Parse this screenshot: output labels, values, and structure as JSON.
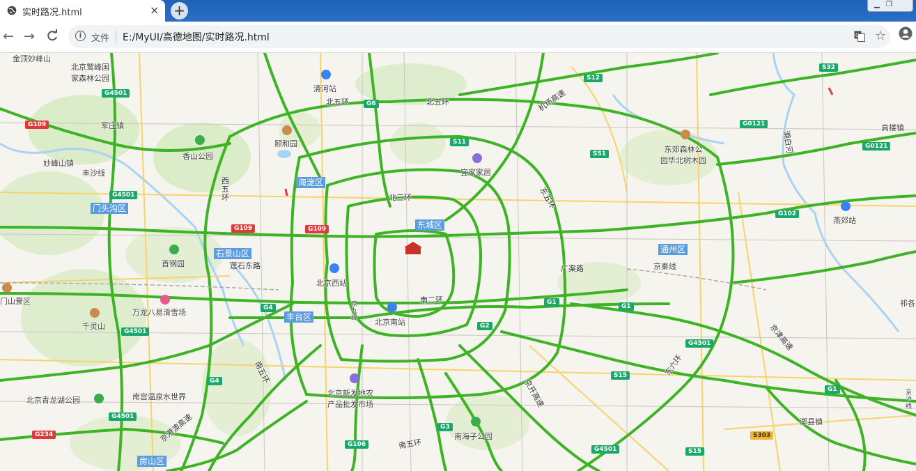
{
  "browser": {
    "tab_title": "实时路况.html",
    "tab_close": "×",
    "new_tab": "+",
    "file_label": "文件",
    "url": "E:/MyUI/高德地图/实时路况.html",
    "back": "←",
    "forward": "→",
    "reload": "C",
    "info": "i",
    "star": "☆"
  },
  "map": {
    "place_labels": [
      {
        "id": "jindingmiaofeng",
        "text": "金顶妙峰山"
      },
      {
        "id": "jingfeng",
        "text": "北京鹫峰国\n家森林公园"
      },
      {
        "id": "qinghe-station",
        "text": "清河站"
      },
      {
        "id": "junzhuang",
        "text": "军庄镇"
      },
      {
        "id": "yiheyuan",
        "text": "颐和园"
      },
      {
        "id": "xiangshan",
        "text": "香山公园"
      },
      {
        "id": "miaofengshan-town",
        "text": "妙峰山镇"
      },
      {
        "id": "fengsha-line",
        "text": "丰沙线"
      },
      {
        "id": "yijiajiayuan",
        "text": "宜家家居"
      },
      {
        "id": "dongjiao",
        "text": "东郊森林公\n园华北树木园"
      },
      {
        "id": "gaolouzhen",
        "text": "高楼镇"
      },
      {
        "id": "yanjiao",
        "text": "燕郊站"
      },
      {
        "id": "shougang",
        "text": "首钢园"
      },
      {
        "id": "mentougou-shan",
        "text": "门山景区"
      },
      {
        "id": "beijing-west",
        "text": "北京西站"
      },
      {
        "id": "wanlong",
        "text": "万龙八易滑雪场"
      },
      {
        "id": "qianlingshan",
        "text": "千灵山"
      },
      {
        "id": "beijing-south",
        "text": "北京南站"
      },
      {
        "id": "jingjiu-line",
        "text": "京\n九\n线"
      },
      {
        "id": "jingqin-line",
        "text": "京秦线"
      },
      {
        "id": "xinfadi",
        "text": "北京新发地农\n产品批发市场"
      },
      {
        "id": "nangong",
        "text": "南宫温泉水世界"
      },
      {
        "id": "qinglonghu",
        "text": "北京青龙湖公园"
      },
      {
        "id": "nanhaizi",
        "text": "南海子公园"
      },
      {
        "id": "lixian",
        "text": "漷县镇"
      },
      {
        "id": "jinghu",
        "text": "京\n沪\n线"
      },
      {
        "id": "qige",
        "text": "祁各"
      }
    ],
    "road_labels": [
      {
        "id": "north5",
        "text": "北五环"
      },
      {
        "id": "north5b",
        "text": "北五环"
      },
      {
        "id": "north3",
        "text": "北三环"
      },
      {
        "id": "airport",
        "text": "机场高速"
      },
      {
        "id": "east5",
        "text": "东五环"
      },
      {
        "id": "west5",
        "text": "西\n五\n环"
      },
      {
        "id": "lianshi",
        "text": "莲石东路"
      },
      {
        "id": "guangqu",
        "text": "广渠路"
      },
      {
        "id": "south2",
        "text": "南二环"
      },
      {
        "id": "south5",
        "text": "南五环"
      },
      {
        "id": "south5b",
        "text": "南五环"
      },
      {
        "id": "jingkai",
        "text": "京开高速"
      },
      {
        "id": "jingzhou",
        "text": "京港澳高速"
      },
      {
        "id": "jingjin",
        "text": "京津高速"
      },
      {
        "id": "east6",
        "text": "东六环"
      },
      {
        "id": "chaobai",
        "text": "潮白河"
      }
    ],
    "districts": [
      {
        "id": "haidian",
        "text": "海淀区"
      },
      {
        "id": "mentougou",
        "text": "门头沟区"
      },
      {
        "id": "dongcheng",
        "text": "东城区"
      },
      {
        "id": "shijingshan",
        "text": "石景山区"
      },
      {
        "id": "fengtai",
        "text": "丰台区"
      },
      {
        "id": "tongzhou",
        "text": "通州区"
      },
      {
        "id": "fangshan",
        "text": "房山区"
      }
    ],
    "shields": [
      {
        "id": "s-g4501-a",
        "text": "G4501",
        "color": "green"
      },
      {
        "id": "s-g109-a",
        "text": "G109",
        "color": "red"
      },
      {
        "id": "s-g6",
        "text": "G6",
        "color": "green"
      },
      {
        "id": "s-s12",
        "text": "S12",
        "color": "green"
      },
      {
        "id": "s-s32",
        "text": "S32",
        "color": "green"
      },
      {
        "id": "s-s11",
        "text": "S11",
        "color": "green"
      },
      {
        "id": "s-s51",
        "text": "S51",
        "color": "green"
      },
      {
        "id": "s-g0121-a",
        "text": "G0121",
        "color": "green"
      },
      {
        "id": "s-g0121-b",
        "text": "G0121",
        "color": "green"
      },
      {
        "id": "s-g4501-b",
        "text": "G4501",
        "color": "green"
      },
      {
        "id": "s-g109-b",
        "text": "G109",
        "color": "red"
      },
      {
        "id": "s-g109-c",
        "text": "G109",
        "color": "red"
      },
      {
        "id": "s-g102",
        "text": "G102",
        "color": "green"
      },
      {
        "id": "s-g4",
        "text": "G4",
        "color": "green"
      },
      {
        "id": "s-g1-a",
        "text": "G1",
        "color": "green"
      },
      {
        "id": "s-g1-b",
        "text": "G1",
        "color": "green"
      },
      {
        "id": "s-g2",
        "text": "G2",
        "color": "green"
      },
      {
        "id": "s-g4501-c",
        "text": "G4501",
        "color": "green"
      },
      {
        "id": "s-g4501-d",
        "text": "G4501",
        "color": "green"
      },
      {
        "id": "s-s15-a",
        "text": "S15",
        "color": "green"
      },
      {
        "id": "s-g4b",
        "text": "G4",
        "color": "green"
      },
      {
        "id": "s-g1-c",
        "text": "G1",
        "color": "green"
      },
      {
        "id": "s-g4501-e",
        "text": "G4501",
        "color": "green"
      },
      {
        "id": "s-g234",
        "text": "G234",
        "color": "red"
      },
      {
        "id": "s-g3",
        "text": "G3",
        "color": "green"
      },
      {
        "id": "s-g106",
        "text": "G106",
        "color": "green"
      },
      {
        "id": "s-s303",
        "text": "S303",
        "color": "yellow"
      },
      {
        "id": "s-g4501-f",
        "text": "G4501",
        "color": "green"
      },
      {
        "id": "s-s15-b",
        "text": "S15",
        "color": "green"
      }
    ],
    "colors": {
      "traffic_clear": "#3db325",
      "ring_yellow": "#f7d36b",
      "water": "#a9d3f5",
      "park": "#cfe8b8",
      "district_bg": "#5b9be0"
    }
  }
}
